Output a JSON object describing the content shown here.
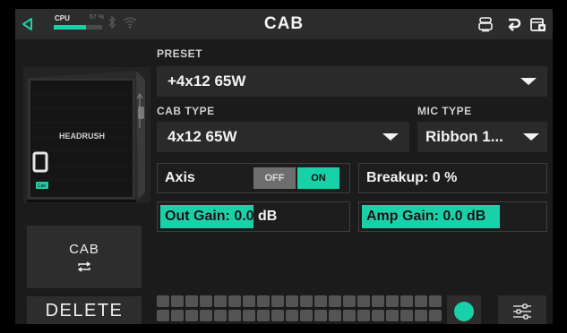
{
  "header": {
    "title": "CAB",
    "cpu_label": "CPU",
    "cpu_percent_label": "67 %",
    "cpu_level": 0.67,
    "icons": [
      "back-arrow-icon",
      "bluetooth-icon",
      "wifi-icon",
      "amp-stack-icon",
      "turn-back-icon",
      "cab-settings-icon"
    ]
  },
  "preset": {
    "label": "PRESET",
    "value": "+4x12 65W"
  },
  "cab_type": {
    "label": "CAB TYPE",
    "value": "4x12 65W"
  },
  "mic_type": {
    "label": "MIC TYPE",
    "value": "Ribbon 1..."
  },
  "axis": {
    "label": "Axis",
    "off_label": "OFF",
    "on_label": "ON",
    "selected": "ON"
  },
  "breakup": {
    "text": "Breakup: 0 %"
  },
  "out_gain": {
    "text": "Out Gain: 0.0 dB",
    "level": 0.5
  },
  "amp_gain": {
    "text": "Amp Gain: 0.0 dB",
    "level": 0.76
  },
  "cabinet": {
    "brand": "HEADRUSH",
    "badge": "Cab"
  },
  "side_button": {
    "label": "CAB",
    "icon": "swap-icon"
  },
  "delete_button": {
    "label": "DELETE"
  },
  "footswitches": {
    "rows": 2,
    "columns": 20
  },
  "colors": {
    "accent": "#19d1a8",
    "panel": "#2a2a2a",
    "background": "#1b1b1b"
  }
}
